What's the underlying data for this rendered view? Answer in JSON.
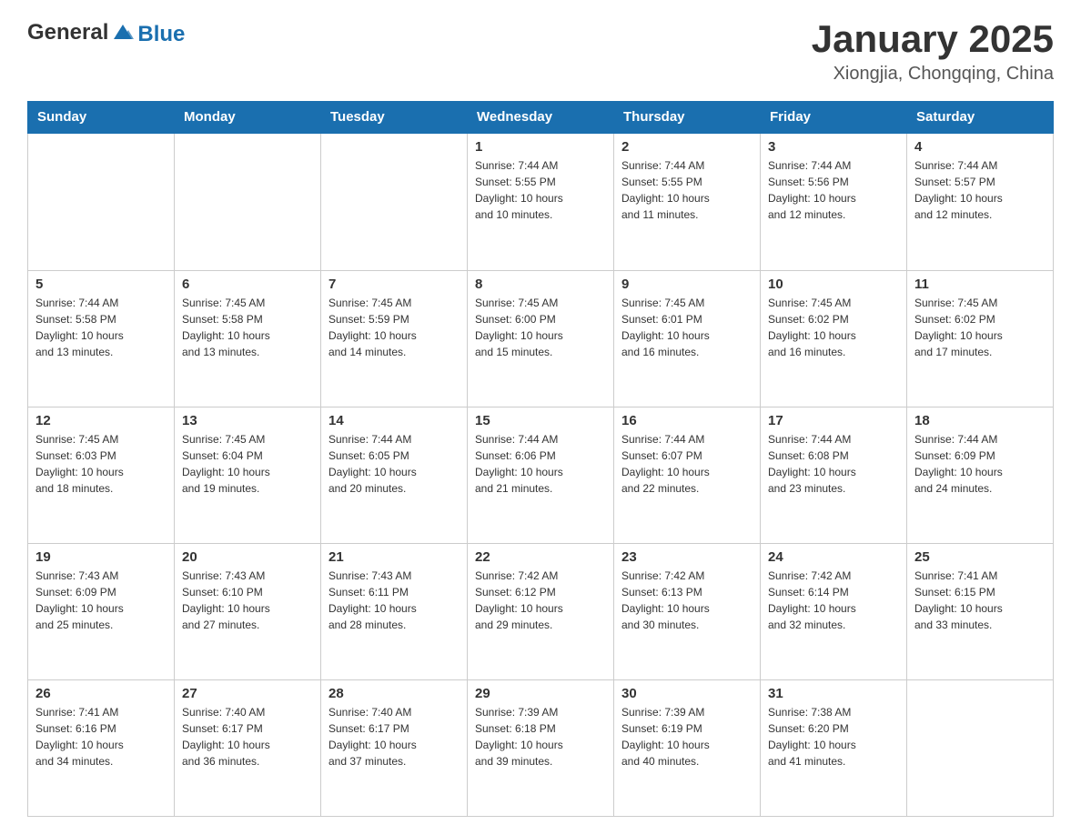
{
  "header": {
    "logo_text_general": "General",
    "logo_text_blue": "Blue",
    "month_year": "January 2025",
    "location": "Xiongjia, Chongqing, China"
  },
  "days_of_week": [
    "Sunday",
    "Monday",
    "Tuesday",
    "Wednesday",
    "Thursday",
    "Friday",
    "Saturday"
  ],
  "weeks": [
    [
      {
        "day": "",
        "info": ""
      },
      {
        "day": "",
        "info": ""
      },
      {
        "day": "",
        "info": ""
      },
      {
        "day": "1",
        "info": "Sunrise: 7:44 AM\nSunset: 5:55 PM\nDaylight: 10 hours\nand 10 minutes."
      },
      {
        "day": "2",
        "info": "Sunrise: 7:44 AM\nSunset: 5:55 PM\nDaylight: 10 hours\nand 11 minutes."
      },
      {
        "day": "3",
        "info": "Sunrise: 7:44 AM\nSunset: 5:56 PM\nDaylight: 10 hours\nand 12 minutes."
      },
      {
        "day": "4",
        "info": "Sunrise: 7:44 AM\nSunset: 5:57 PM\nDaylight: 10 hours\nand 12 minutes."
      }
    ],
    [
      {
        "day": "5",
        "info": "Sunrise: 7:44 AM\nSunset: 5:58 PM\nDaylight: 10 hours\nand 13 minutes."
      },
      {
        "day": "6",
        "info": "Sunrise: 7:45 AM\nSunset: 5:58 PM\nDaylight: 10 hours\nand 13 minutes."
      },
      {
        "day": "7",
        "info": "Sunrise: 7:45 AM\nSunset: 5:59 PM\nDaylight: 10 hours\nand 14 minutes."
      },
      {
        "day": "8",
        "info": "Sunrise: 7:45 AM\nSunset: 6:00 PM\nDaylight: 10 hours\nand 15 minutes."
      },
      {
        "day": "9",
        "info": "Sunrise: 7:45 AM\nSunset: 6:01 PM\nDaylight: 10 hours\nand 16 minutes."
      },
      {
        "day": "10",
        "info": "Sunrise: 7:45 AM\nSunset: 6:02 PM\nDaylight: 10 hours\nand 16 minutes."
      },
      {
        "day": "11",
        "info": "Sunrise: 7:45 AM\nSunset: 6:02 PM\nDaylight: 10 hours\nand 17 minutes."
      }
    ],
    [
      {
        "day": "12",
        "info": "Sunrise: 7:45 AM\nSunset: 6:03 PM\nDaylight: 10 hours\nand 18 minutes."
      },
      {
        "day": "13",
        "info": "Sunrise: 7:45 AM\nSunset: 6:04 PM\nDaylight: 10 hours\nand 19 minutes."
      },
      {
        "day": "14",
        "info": "Sunrise: 7:44 AM\nSunset: 6:05 PM\nDaylight: 10 hours\nand 20 minutes."
      },
      {
        "day": "15",
        "info": "Sunrise: 7:44 AM\nSunset: 6:06 PM\nDaylight: 10 hours\nand 21 minutes."
      },
      {
        "day": "16",
        "info": "Sunrise: 7:44 AM\nSunset: 6:07 PM\nDaylight: 10 hours\nand 22 minutes."
      },
      {
        "day": "17",
        "info": "Sunrise: 7:44 AM\nSunset: 6:08 PM\nDaylight: 10 hours\nand 23 minutes."
      },
      {
        "day": "18",
        "info": "Sunrise: 7:44 AM\nSunset: 6:09 PM\nDaylight: 10 hours\nand 24 minutes."
      }
    ],
    [
      {
        "day": "19",
        "info": "Sunrise: 7:43 AM\nSunset: 6:09 PM\nDaylight: 10 hours\nand 25 minutes."
      },
      {
        "day": "20",
        "info": "Sunrise: 7:43 AM\nSunset: 6:10 PM\nDaylight: 10 hours\nand 27 minutes."
      },
      {
        "day": "21",
        "info": "Sunrise: 7:43 AM\nSunset: 6:11 PM\nDaylight: 10 hours\nand 28 minutes."
      },
      {
        "day": "22",
        "info": "Sunrise: 7:42 AM\nSunset: 6:12 PM\nDaylight: 10 hours\nand 29 minutes."
      },
      {
        "day": "23",
        "info": "Sunrise: 7:42 AM\nSunset: 6:13 PM\nDaylight: 10 hours\nand 30 minutes."
      },
      {
        "day": "24",
        "info": "Sunrise: 7:42 AM\nSunset: 6:14 PM\nDaylight: 10 hours\nand 32 minutes."
      },
      {
        "day": "25",
        "info": "Sunrise: 7:41 AM\nSunset: 6:15 PM\nDaylight: 10 hours\nand 33 minutes."
      }
    ],
    [
      {
        "day": "26",
        "info": "Sunrise: 7:41 AM\nSunset: 6:16 PM\nDaylight: 10 hours\nand 34 minutes."
      },
      {
        "day": "27",
        "info": "Sunrise: 7:40 AM\nSunset: 6:17 PM\nDaylight: 10 hours\nand 36 minutes."
      },
      {
        "day": "28",
        "info": "Sunrise: 7:40 AM\nSunset: 6:17 PM\nDaylight: 10 hours\nand 37 minutes."
      },
      {
        "day": "29",
        "info": "Sunrise: 7:39 AM\nSunset: 6:18 PM\nDaylight: 10 hours\nand 39 minutes."
      },
      {
        "day": "30",
        "info": "Sunrise: 7:39 AM\nSunset: 6:19 PM\nDaylight: 10 hours\nand 40 minutes."
      },
      {
        "day": "31",
        "info": "Sunrise: 7:38 AM\nSunset: 6:20 PM\nDaylight: 10 hours\nand 41 minutes."
      },
      {
        "day": "",
        "info": ""
      }
    ]
  ]
}
